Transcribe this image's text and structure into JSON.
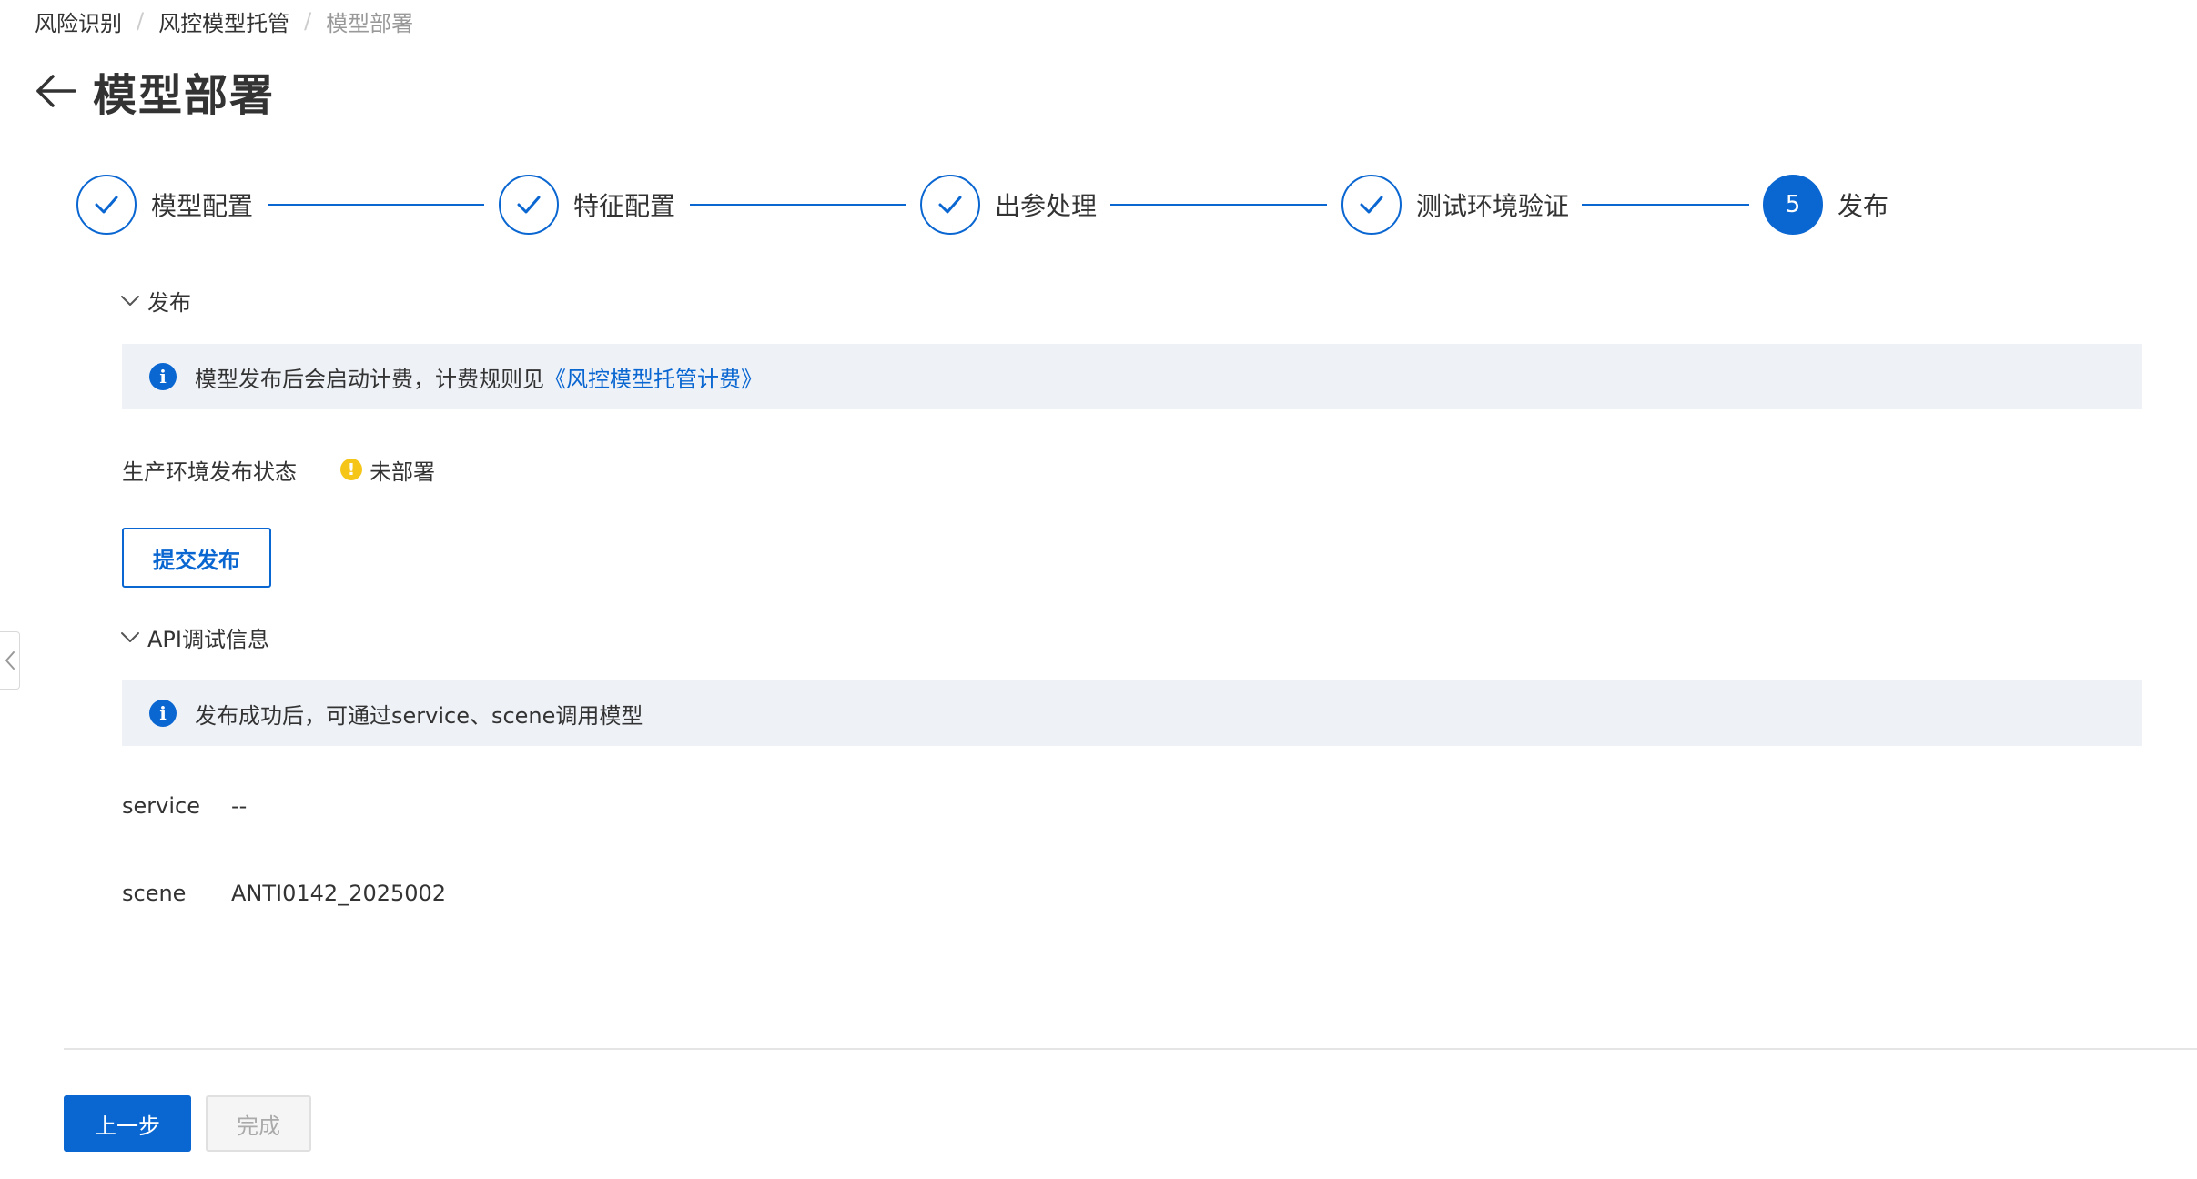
{
  "breadcrumb": {
    "items": [
      "风险识别",
      "风控模型托管",
      "模型部署"
    ],
    "separator": "/"
  },
  "header": {
    "title": "模型部署",
    "back_icon": "arrow-left-icon"
  },
  "steps": [
    {
      "label": "模型配置",
      "status": "done",
      "icon": "check-icon"
    },
    {
      "label": "特征配置",
      "status": "done",
      "icon": "check-icon"
    },
    {
      "label": "出参处理",
      "status": "done",
      "icon": "check-icon"
    },
    {
      "label": "测试环境验证",
      "status": "done",
      "icon": "check-icon"
    },
    {
      "label": "发布",
      "status": "active",
      "number": "5"
    }
  ],
  "publish": {
    "section_title": "发布",
    "alert_text": "模型发布后会启动计费，计费规则见",
    "alert_link": "《风控模型托管计费》",
    "status_label": "生产环境发布状态",
    "status_value": "未部署",
    "submit_label": "提交发布"
  },
  "api": {
    "section_title": "API调试信息",
    "alert_text": "发布成功后，可通过service、scene调用模型",
    "service_label": "service",
    "service_value": "--",
    "scene_label": "scene",
    "scene_value": "ANTI0142_2025002"
  },
  "footer": {
    "prev_label": "上一步",
    "finish_label": "完成"
  },
  "colors": {
    "primary": "#0a66d1",
    "warning": "#f5c518",
    "alert_bg": "#eef2f7"
  }
}
